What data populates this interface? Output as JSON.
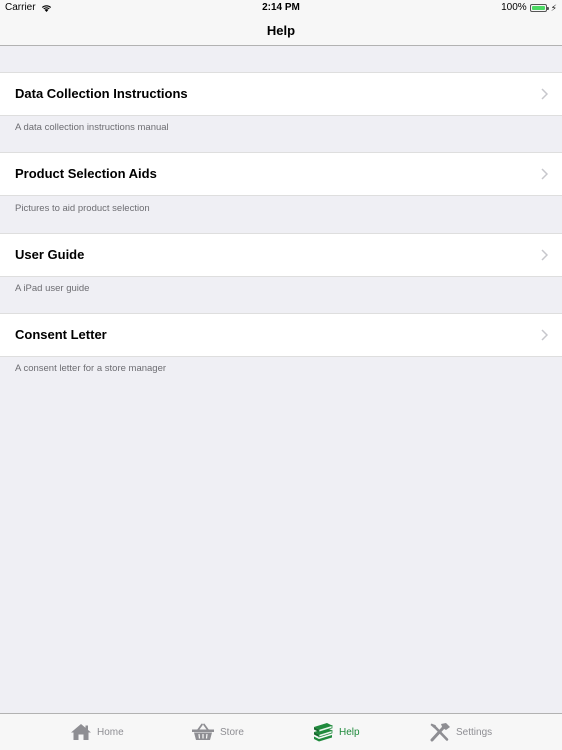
{
  "status_bar": {
    "carrier": "Carrier",
    "time": "2:14 PM",
    "battery": "100%"
  },
  "nav": {
    "title": "Help"
  },
  "sections": [
    {
      "label": "Data Collection Instructions",
      "footer": "A data collection instructions manual"
    },
    {
      "label": "Product Selection Aids",
      "footer": "Pictures to aid product selection"
    },
    {
      "label": "User Guide",
      "footer": "A iPad user guide"
    },
    {
      "label": "Consent Letter",
      "footer": "A consent letter for a store manager"
    }
  ],
  "tabs": [
    {
      "label": "Home",
      "icon": "home-icon",
      "active": false
    },
    {
      "label": "Store",
      "icon": "basket-icon",
      "active": false
    },
    {
      "label": "Help",
      "icon": "books-icon",
      "active": true
    },
    {
      "label": "Settings",
      "icon": "tools-icon",
      "active": false
    }
  ],
  "colors": {
    "accent": "#1f8a3c",
    "inactive": "#8e8e93",
    "background": "#efeff4"
  }
}
